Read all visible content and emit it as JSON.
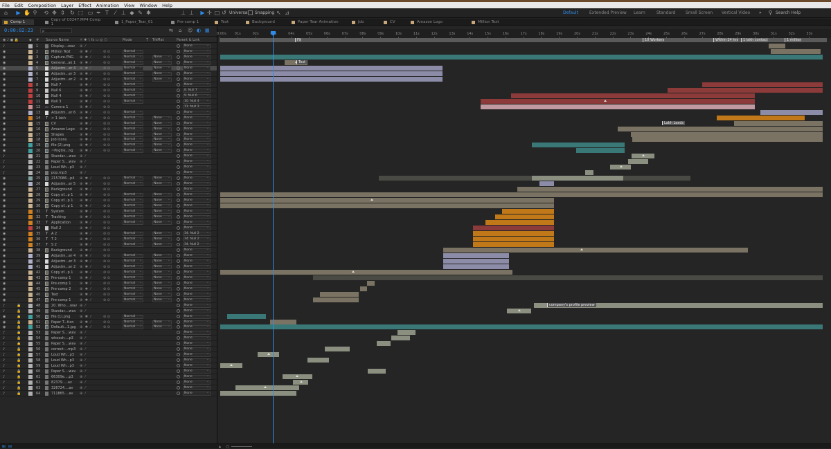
{
  "menu": [
    "File",
    "Edit",
    "Composition",
    "Layer",
    "Effect",
    "Animation",
    "View",
    "Window",
    "Help"
  ],
  "workspaces": [
    {
      "label": "Default",
      "active": true
    },
    {
      "label": "Extended Preview",
      "active": false
    },
    {
      "label": "Learn",
      "active": false
    },
    {
      "label": "Standard",
      "active": false
    },
    {
      "label": "Small Screen",
      "active": false
    },
    {
      "label": "Vertical Video",
      "active": false
    }
  ],
  "toolbar": {
    "universal_label": "Universal",
    "snapping_label": "Snapping",
    "search_placeholder": "Search Help",
    "more_glyph": "»"
  },
  "tabs": [
    {
      "label": "Comp 1",
      "color": "#d0a030",
      "active": true
    },
    {
      "label": "Copy of C0247.MP4 Comp 1",
      "color": "#8a8a8a",
      "active": false
    },
    {
      "label": "1_Paper_Tear_01",
      "color": "#8a8a8a",
      "active": false
    },
    {
      "label": "Pre-comp 1",
      "color": "#8a8a8a",
      "active": false
    },
    {
      "label": "Text",
      "color": "#c8a878",
      "active": false
    },
    {
      "label": "Background",
      "color": "#c8a878",
      "active": false
    },
    {
      "label": "Paper Tear Animation",
      "color": "#c8a878",
      "active": false
    },
    {
      "label": "Job",
      "color": "#c8a878",
      "active": false
    },
    {
      "label": "CV",
      "color": "#c8a878",
      "active": false
    },
    {
      "label": "Amazon Logo",
      "color": "#c8a878",
      "active": false
    },
    {
      "label": "Million Text",
      "color": "#c8a878",
      "active": false
    }
  ],
  "timecode": "0:00:02:23",
  "search_glyph": "ρ",
  "columns": {
    "name": "Source Name",
    "mode": "Mode",
    "t": "T",
    "trkmat": "TrkMat",
    "parent": "Parent & Link"
  },
  "ruler_ticks": [
    "0:00s",
    "01s",
    "02s",
    "03s",
    "04s",
    "05s",
    "06s",
    "07s",
    "08s",
    "09s",
    "10s",
    "11s",
    "12s",
    "13s",
    "14s",
    "15s",
    "16s",
    "17s",
    "18s",
    "19s",
    "20s",
    "21s",
    "22s",
    "23s",
    "24s",
    "25s",
    "26s",
    "27s",
    "28s",
    "29s",
    "30s",
    "31s",
    "32s",
    "33s"
  ],
  "markers": [
    "Fit",
    "10 Workers",
    "Within 24 hrs",
    "1 lakh contact",
    "1 million"
  ],
  "bar_labels": [
    "Text",
    "Lakh Leads",
    "company's profile preview"
  ],
  "layers": [
    {
      "n": "1",
      "name": "Display....wav",
      "color": "#b0b0b0",
      "type": "audio",
      "mode": "",
      "trk": "",
      "parent": "None"
    },
    {
      "n": "2",
      "name": "Million Text",
      "color": "#c8b090",
      "type": "comp",
      "mode": "Normal",
      "trk": "",
      "parent": "None"
    },
    {
      "n": "3",
      "name": "Capture.PNG",
      "color": "#c8b090",
      "type": "img",
      "mode": "Normal",
      "trk": "None",
      "parent": "None"
    },
    {
      "n": "4",
      "name": "General...ak 1",
      "color": "#c8b090",
      "type": "comp",
      "mode": "Normal",
      "trk": "None",
      "parent": "None"
    },
    {
      "n": "5",
      "name": "Adjustm...er 4",
      "color": "#b0b0c8",
      "type": "box",
      "mode": "Normal",
      "trk": "None",
      "parent": "None",
      "sel": true
    },
    {
      "n": "6",
      "name": "Adjustm...er 3",
      "color": "#b0b0c8",
      "type": "box",
      "mode": "Normal",
      "trk": "None",
      "parent": "None"
    },
    {
      "n": "7",
      "name": "Adjustm...er 2",
      "color": "#b0b0c8",
      "type": "box",
      "mode": "Normal",
      "trk": "None",
      "parent": "None"
    },
    {
      "n": "8",
      "name": "Null 7",
      "color": "#c04040",
      "type": "null",
      "mode": "Normal",
      "trk": "",
      "parent": "None"
    },
    {
      "n": "9",
      "name": "Null 6",
      "color": "#c04040",
      "type": "null",
      "mode": "Normal",
      "trk": "",
      "parent": "8. Null 7"
    },
    {
      "n": "10",
      "name": "Null 4",
      "color": "#c04040",
      "type": "null",
      "mode": "Normal",
      "trk": "",
      "parent": "9. Null 6"
    },
    {
      "n": "11",
      "name": "Null 3",
      "color": "#c04040",
      "type": "null",
      "mode": "Normal",
      "trk": "",
      "parent": "10. Null 4"
    },
    {
      "n": "12",
      "name": "Camera 1",
      "color": "#d09090",
      "type": "cam",
      "mode": "",
      "trk": "",
      "parent": "11. Null 3"
    },
    {
      "n": "13",
      "name": "Adjustm...er 6",
      "color": "#b0b0c8",
      "type": "box",
      "mode": "Normal",
      "trk": "",
      "parent": "None"
    },
    {
      "n": "14",
      "name": "> 1 lakh",
      "color": "#d08020",
      "type": "text",
      "mode": "Normal",
      "trk": "None",
      "parent": "None"
    },
    {
      "n": "15",
      "name": "CV",
      "color": "#c8b090",
      "type": "comp",
      "mode": "Normal",
      "trk": "None",
      "parent": "None"
    },
    {
      "n": "16",
      "name": "Amazon Logo",
      "color": "#c8b090",
      "type": "comp",
      "mode": "Normal",
      "trk": "None",
      "parent": "None"
    },
    {
      "n": "17",
      "name": "Shapes",
      "color": "#c8b090",
      "type": "comp",
      "mode": "Normal",
      "trk": "None",
      "parent": "None"
    },
    {
      "n": "18",
      "name": "Job Icons",
      "color": "#c8b090",
      "type": "comp",
      "mode": "Normal",
      "trk": "None",
      "parent": "None"
    },
    {
      "n": "19",
      "name": "file (2).png",
      "color": "#40a0a0",
      "type": "img",
      "mode": "Normal",
      "trk": "None",
      "parent": "None"
    },
    {
      "n": "20",
      "name": "~Pngtre...ng",
      "color": "#40a0a0",
      "type": "img",
      "mode": "Normal",
      "trk": "None",
      "parent": "None"
    },
    {
      "n": "21",
      "name": "Standar....wav",
      "color": "#b0b0b0",
      "type": "audio",
      "mode": "",
      "trk": "",
      "parent": "None"
    },
    {
      "n": "22",
      "name": "Paper S....wav",
      "color": "#b0b0b0",
      "type": "audio",
      "mode": "",
      "trk": "",
      "parent": "None"
    },
    {
      "n": "23",
      "name": "Loud Wh...p3",
      "color": "#b0b0b0",
      "type": "audio",
      "mode": "",
      "trk": "",
      "parent": "None"
    },
    {
      "n": "24",
      "name": "pop.mp3",
      "color": "#b0b0b0",
      "type": "audio",
      "mode": "",
      "trk": "",
      "parent": "None"
    },
    {
      "n": "25",
      "name": "2157086...p4",
      "color": "#80a0a0",
      "type": "img",
      "mode": "Normal",
      "trk": "None",
      "parent": "None"
    },
    {
      "n": "26",
      "name": "Adjustm...er 5",
      "color": "#b0b0c8",
      "type": "box",
      "mode": "Normal",
      "trk": "None",
      "parent": "None"
    },
    {
      "n": "27",
      "name": "Background",
      "color": "#c8b090",
      "type": "comp",
      "mode": "",
      "trk": "",
      "parent": "None"
    },
    {
      "n": "28",
      "name": "Copy of...p 1",
      "color": "#c8b090",
      "type": "comp",
      "mode": "Normal",
      "trk": "None",
      "parent": "None"
    },
    {
      "n": "29",
      "name": "Copy of...p 1",
      "color": "#c8b090",
      "type": "comp",
      "mode": "Normal",
      "trk": "None",
      "parent": "None"
    },
    {
      "n": "30",
      "name": "Copy of...p 1",
      "color": "#c8b090",
      "type": "comp",
      "mode": "Normal",
      "trk": "None",
      "parent": "None"
    },
    {
      "n": "31",
      "name": "System",
      "color": "#d08020",
      "type": "text",
      "mode": "Normal",
      "trk": "None",
      "parent": "None"
    },
    {
      "n": "32",
      "name": "Tracking",
      "color": "#d08020",
      "type": "text",
      "mode": "Normal",
      "trk": "None",
      "parent": "None"
    },
    {
      "n": "33",
      "name": "Application",
      "color": "#d08020",
      "type": "text",
      "mode": "Normal",
      "trk": "None",
      "parent": "None"
    },
    {
      "n": "34",
      "name": "Null 2",
      "color": "#c04040",
      "type": "null",
      "mode": "",
      "trk": "",
      "parent": "None"
    },
    {
      "n": "35",
      "name": "A 2",
      "color": "#d08020",
      "type": "text",
      "mode": "Normal",
      "trk": "None",
      "parent": "34. Null 2"
    },
    {
      "n": "36",
      "name": "T 2",
      "color": "#d08020",
      "type": "text",
      "mode": "Normal",
      "trk": "None",
      "parent": "34. Null 2"
    },
    {
      "n": "37",
      "name": "S 2",
      "color": "#d08020",
      "type": "text",
      "mode": "Normal",
      "trk": "None",
      "parent": "34. Null 2"
    },
    {
      "n": "38",
      "name": "Background",
      "color": "#c8b090",
      "type": "comp",
      "mode": "",
      "trk": "",
      "parent": "None"
    },
    {
      "n": "39",
      "name": "Adjustm...er 4",
      "color": "#b0b0c8",
      "type": "box",
      "mode": "Normal",
      "trk": "None",
      "parent": "None"
    },
    {
      "n": "40",
      "name": "Adjustm...er 3",
      "color": "#b0b0c8",
      "type": "box",
      "mode": "Normal",
      "trk": "None",
      "parent": "None"
    },
    {
      "n": "41",
      "name": "Adjustm...er 2",
      "color": "#b0b0c8",
      "type": "box",
      "mode": "Normal",
      "trk": "None",
      "parent": "None"
    },
    {
      "n": "42",
      "name": "Copy of...p 1",
      "color": "#c8b090",
      "type": "comp",
      "mode": "Normal",
      "trk": "None",
      "parent": "None"
    },
    {
      "n": "43",
      "name": "Pre-comp 1",
      "color": "#c8b090",
      "type": "comp",
      "mode": "Normal",
      "trk": "None",
      "parent": "None"
    },
    {
      "n": "44",
      "name": "Pre-comp 1",
      "color": "#c8b090",
      "type": "comp",
      "mode": "Normal",
      "trk": "None",
      "parent": "None"
    },
    {
      "n": "45",
      "name": "Pre-comp 2",
      "color": "#c8b090",
      "type": "comp",
      "mode": "Normal",
      "trk": "None",
      "parent": "None"
    },
    {
      "n": "46",
      "name": "Text",
      "color": "#c8b090",
      "type": "comp",
      "mode": "Normal",
      "trk": "None",
      "parent": "None"
    },
    {
      "n": "47",
      "name": "Pre-comp 1",
      "color": "#c8b090",
      "type": "comp",
      "mode": "Normal",
      "trk": "None",
      "parent": "None"
    },
    {
      "n": "48",
      "name": "20. Who....wav",
      "color": "#b0b0b0",
      "type": "audio",
      "mode": "",
      "trk": "",
      "parent": "None"
    },
    {
      "n": "49",
      "name": "Standar....wav",
      "color": "#b0b0b0",
      "type": "audio",
      "mode": "",
      "trk": "",
      "parent": "None"
    },
    {
      "n": "50",
      "name": "file (1).png",
      "color": "#40a0a0",
      "type": "img",
      "mode": "Normal",
      "trk": "",
      "parent": "None"
    },
    {
      "n": "51",
      "name": "Paper T...tion",
      "color": "#c8b090",
      "type": "comp",
      "mode": "Normal",
      "trk": "None",
      "parent": "None"
    },
    {
      "n": "52",
      "name": "Default...1.jpg",
      "color": "#40a0a0",
      "type": "img",
      "mode": "Normal",
      "trk": "None",
      "parent": "None"
    },
    {
      "n": "53",
      "name": "Paper S....wav",
      "color": "#b0b0b0",
      "type": "audio",
      "mode": "",
      "trk": "",
      "parent": "None"
    },
    {
      "n": "54",
      "name": "whoosh....p3",
      "color": "#b0b0b0",
      "type": "audio",
      "mode": "",
      "trk": "",
      "parent": "None"
    },
    {
      "n": "55",
      "name": "Paper S....wav",
      "color": "#b0b0b0",
      "type": "audio",
      "mode": "",
      "trk": "",
      "parent": "None"
    },
    {
      "n": "56",
      "name": "correct-...mp3",
      "color": "#b0b0b0",
      "type": "audio",
      "mode": "",
      "trk": "",
      "parent": "None"
    },
    {
      "n": "57",
      "name": "Loud Wh...p3",
      "color": "#b0b0b0",
      "type": "audio",
      "mode": "",
      "trk": "",
      "parent": "None"
    },
    {
      "n": "58",
      "name": "Loud Wh...p3",
      "color": "#b0b0b0",
      "type": "audio",
      "mode": "",
      "trk": "",
      "parent": "None"
    },
    {
      "n": "59",
      "name": "Loud Wh...p3",
      "color": "#b0b0b0",
      "type": "audio",
      "mode": "",
      "trk": "",
      "parent": "None"
    },
    {
      "n": "60",
      "name": "Paper S....wav",
      "color": "#b0b0b0",
      "type": "audio",
      "mode": "",
      "trk": "",
      "parent": "None"
    },
    {
      "n": "61",
      "name": "66309e....p3",
      "color": "#b0b0b0",
      "type": "audio",
      "mode": "",
      "trk": "",
      "parent": "None"
    },
    {
      "n": "62",
      "name": "82379.....av",
      "color": "#b0b0b0",
      "type": "audio",
      "mode": "",
      "trk": "",
      "parent": "None"
    },
    {
      "n": "63",
      "name": "326724....av",
      "color": "#b0b0b0",
      "type": "audio",
      "mode": "",
      "trk": "",
      "parent": "None"
    },
    {
      "n": "64",
      "name": "711865....av",
      "color": "#b0b0b0",
      "type": "audio",
      "mode": "",
      "trk": "",
      "parent": "None"
    }
  ],
  "bar_colors": {
    "comp": "#7a7262",
    "adj": "#8c8ca8",
    "null": "#8c3a3a",
    "text": "#c07818",
    "teal": "#3a7878",
    "audio": "#8a8f80",
    "cam": "#c09aa0",
    "dark": "#4a4a44"
  },
  "accent": "#2d8ceb"
}
